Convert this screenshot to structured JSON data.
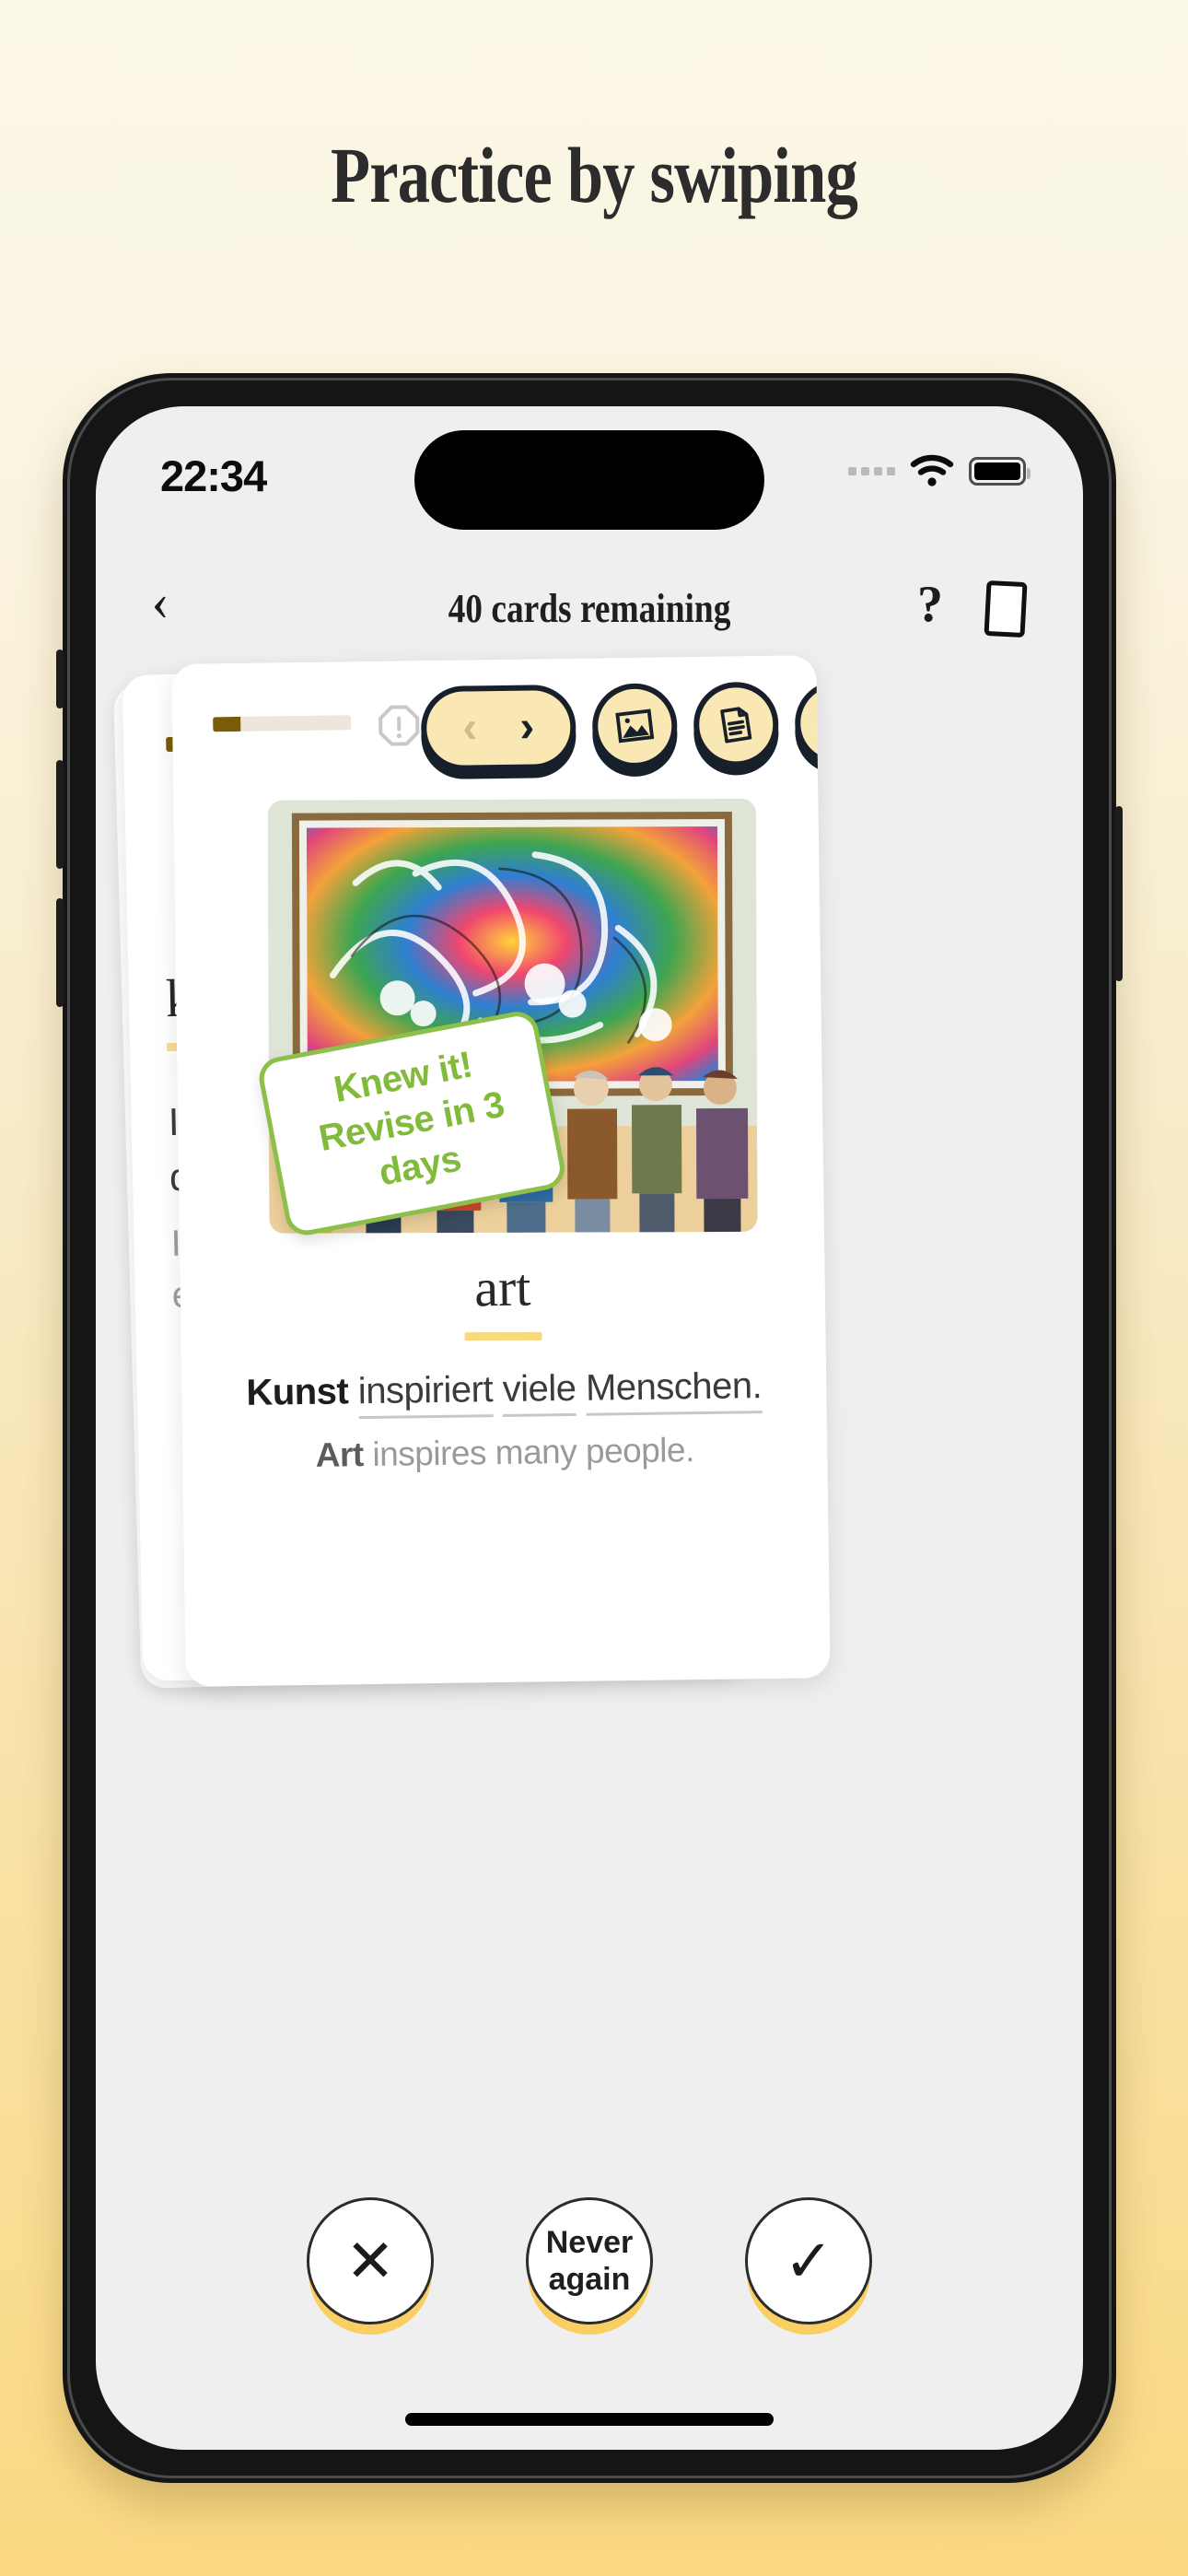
{
  "headline": "Practice by swiping",
  "theme": {
    "bg_top": "#fbf7e7",
    "bg_bottom": "#fbd982",
    "accent_yellow": "#fae8b4",
    "ink": "#17202a",
    "badge_green": "#82bb3c",
    "underline_gold": "#f9d97e"
  },
  "status_bar": {
    "time": "22:34",
    "signal_icon": "signal-dots-icon",
    "wifi_icon": "wifi-icon",
    "battery_icon": "battery-icon"
  },
  "nav": {
    "back_icon": "chevron-left-icon",
    "title": "40 cards remaining",
    "help_label": "?",
    "deck_icon": "card-deck-icon"
  },
  "card_toolbar": {
    "prev_icon": "chevron-left-icon",
    "next_icon": "chevron-right-icon",
    "image_icon": "image-icon",
    "document_icon": "document-icon",
    "audio_icon": "speaker-icon",
    "warning_icon": "exclamation-octagon-icon",
    "progress_percent": 20
  },
  "front_card": {
    "illustration_alt": "gallery-visitors-viewing-colorful-swirl-painting",
    "badge": {
      "line1": "Knew it!",
      "line2": "Revise in 3 days"
    },
    "word": "art",
    "sentence_de": [
      {
        "text": "Kunst",
        "bold": true,
        "underline": false
      },
      {
        "text": "inspiriert",
        "bold": false,
        "underline": true
      },
      {
        "text": "viele",
        "bold": false,
        "underline": true
      },
      {
        "text": "Menschen.",
        "bold": false,
        "underline": true
      }
    ],
    "sentence_en_bold": "Art",
    "sentence_en_rest": "inspires many people."
  },
  "back_card": {
    "word": "kilo",
    "line1": "Ich",
    "line2": "der",
    "line3": "I rid",
    "line4": "eve"
  },
  "actions": [
    {
      "name": "forgot",
      "icon": "close-x-icon",
      "glyph": "✕",
      "label": ""
    },
    {
      "name": "never-again",
      "icon": "",
      "glyph": "",
      "label_line1": "Never",
      "label_line2": "again"
    },
    {
      "name": "knew-it",
      "icon": "check-icon",
      "glyph": "✓",
      "label": ""
    }
  ]
}
